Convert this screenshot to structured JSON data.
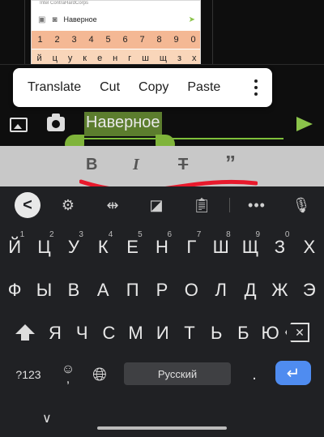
{
  "thumbnail": {
    "user_text": "Intel ContraHardCorps",
    "input_text": "Наверное",
    "number_row": [
      "1",
      "2",
      "3",
      "4",
      "5",
      "6",
      "7",
      "8",
      "9",
      "0"
    ],
    "letter_row": [
      "й",
      "ц",
      "у",
      "к",
      "е",
      "н",
      "г",
      "ш",
      "щ",
      "з",
      "х"
    ]
  },
  "context_menu": {
    "items": [
      "Translate",
      "Cut",
      "Copy",
      "Paste"
    ]
  },
  "composer": {
    "text": "Наверное"
  },
  "format_bar": {
    "bold": "B",
    "italic": "I",
    "strike": "T",
    "quote": "”"
  },
  "keyboard": {
    "toolbar": {
      "back": "<",
      "more": "•••"
    },
    "row1": [
      {
        "key": "Й",
        "hint": "1"
      },
      {
        "key": "Ц",
        "hint": "2"
      },
      {
        "key": "У",
        "hint": "3"
      },
      {
        "key": "К",
        "hint": "4"
      },
      {
        "key": "Е",
        "hint": "5"
      },
      {
        "key": "Н",
        "hint": "6"
      },
      {
        "key": "Г",
        "hint": "7"
      },
      {
        "key": "Ш",
        "hint": "8"
      },
      {
        "key": "Щ",
        "hint": "9"
      },
      {
        "key": "З",
        "hint": "0"
      },
      {
        "key": "Х",
        "hint": ""
      }
    ],
    "row2": [
      "Ф",
      "Ы",
      "В",
      "А",
      "П",
      "Р",
      "О",
      "Л",
      "Д",
      "Ж",
      "Э"
    ],
    "row3": [
      "Я",
      "Ч",
      "С",
      "М",
      "И",
      "Т",
      "Ь",
      "Б",
      "Ю"
    ],
    "symbols_label": "?123",
    "emoji_label": "☺",
    "comma_label": ",",
    "space_label": "Русский",
    "period_label": ".",
    "enter_label": "↵",
    "hide_label": "∨"
  }
}
